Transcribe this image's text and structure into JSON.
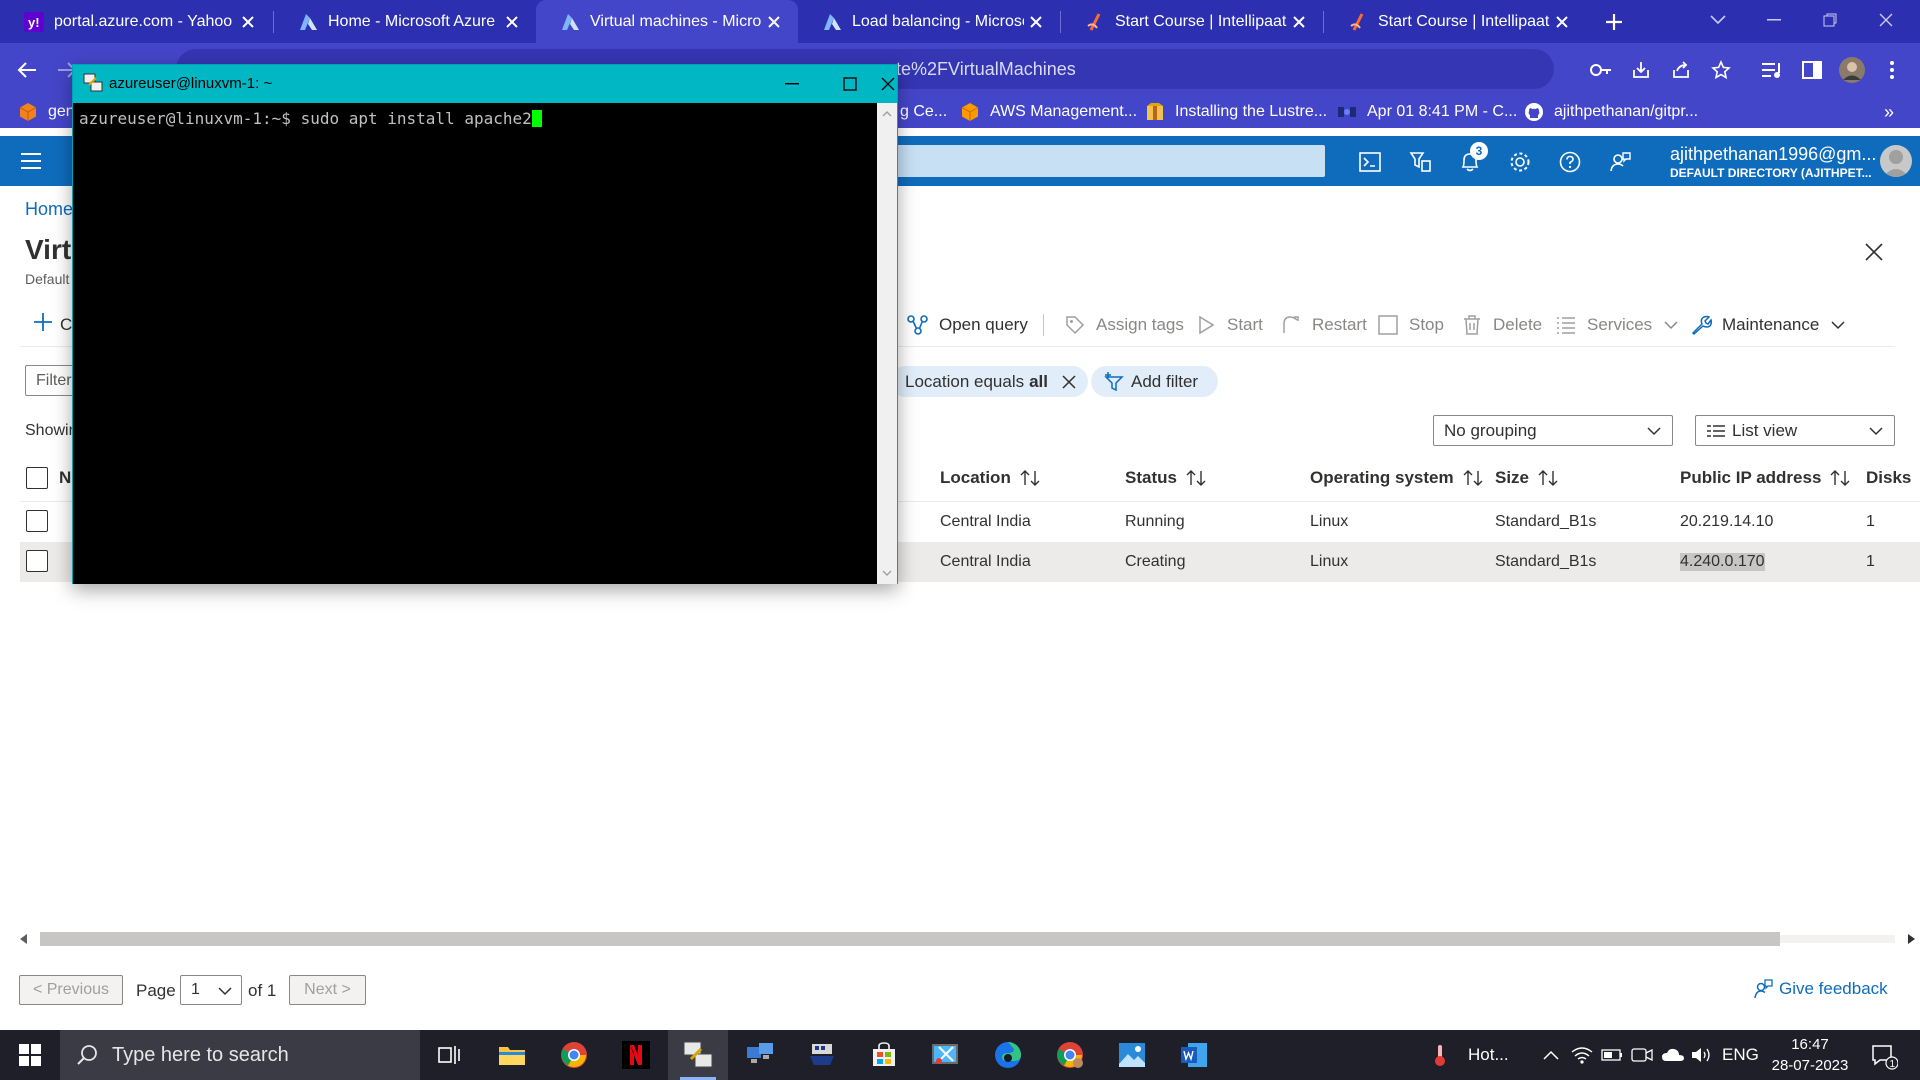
{
  "browser": {
    "tabs": [
      {
        "title": "portal.azure.com - Yahoo In",
        "favicon": "yahoo-icon"
      },
      {
        "title": "Home - Microsoft Azure",
        "favicon": "azure-icon"
      },
      {
        "title": "Virtual machines - Microsof",
        "favicon": "azure-icon",
        "active": true
      },
      {
        "title": "Load balancing - Microsoft",
        "favicon": "azure-icon"
      },
      {
        "title": "Start Course | Intellipaat",
        "favicon": "intellipaat-icon"
      },
      {
        "title": "Start Course | Intellipaat",
        "favicon": "intellipaat-icon"
      }
    ],
    "address_visible": "te%2FVirtualMachines",
    "bookmarks": [
      {
        "label": "gen",
        "icon": "orange-cube-icon"
      },
      {
        "label": "g Ce...",
        "icon": ""
      },
      {
        "label": "AWS Management...",
        "icon": "aws-icon"
      },
      {
        "label": "Installing the Lustre...",
        "icon": "package-icon"
      },
      {
        "label": "Apr 01 8:41 PM - C...",
        "icon": "app-icon"
      },
      {
        "label": "ajithpethanan/gitpr...",
        "icon": "github-icon"
      }
    ],
    "bookmarks_more": "»"
  },
  "azure": {
    "notification_count": "3",
    "account": {
      "email": "ajithpethanan1996@gm...",
      "directory": "DEFAULT DIRECTORY (AJITHPET..."
    },
    "breadcrumb": "Home",
    "page_title": "Virt",
    "page_subtitle": "Default",
    "create_label": "C",
    "commands": {
      "open_query": "Open query",
      "assign_tags": "Assign tags",
      "start": "Start",
      "restart": "Restart",
      "stop": "Stop",
      "delete": "Delete",
      "services": "Services",
      "maintenance": "Maintenance"
    },
    "filter_placeholder": "Filter",
    "location_filter": {
      "prefix": "Location equals",
      "value": "all"
    },
    "add_filter": "Add filter",
    "showing": "Showin",
    "grouping": "No grouping",
    "view": "List view",
    "table": {
      "name_header": "N",
      "columns": [
        "Location",
        "Status",
        "Operating system",
        "Size",
        "Public IP address",
        "Disks"
      ],
      "rows": [
        {
          "location": "Central India",
          "status": "Running",
          "os": "Linux",
          "size": "Standard_B1s",
          "ip": "20.219.14.10",
          "disks": "1"
        },
        {
          "location": "Central India",
          "status": "Creating",
          "os": "Linux",
          "size": "Standard_B1s",
          "ip": "4.240.0.170",
          "disks": "1"
        }
      ]
    },
    "pager": {
      "previous": "< Previous",
      "page_label": "Page",
      "page": "1",
      "of": "of 1",
      "next": "Next >"
    },
    "feedback": "Give feedback"
  },
  "putty": {
    "title": "azureuser@linuxvm-1: ~",
    "prompt": "azureuser@linuxvm-1:~$ ",
    "command": "sudo apt install apache2"
  },
  "taskbar": {
    "search_placeholder": "Type here to search",
    "weather": "Hot...",
    "language": "ENG",
    "time": "16:47",
    "date": "28-07-2023",
    "notifications": "1"
  },
  "colors": {
    "chrome_tabstrip": "#2b2fb0",
    "chrome_toolbar": "#4446c9",
    "azure_header": "#0f6cbd",
    "putty_frame": "#00b7c3",
    "terminal_cursor": "#00ff00",
    "taskbar": "#1f1f2a"
  }
}
